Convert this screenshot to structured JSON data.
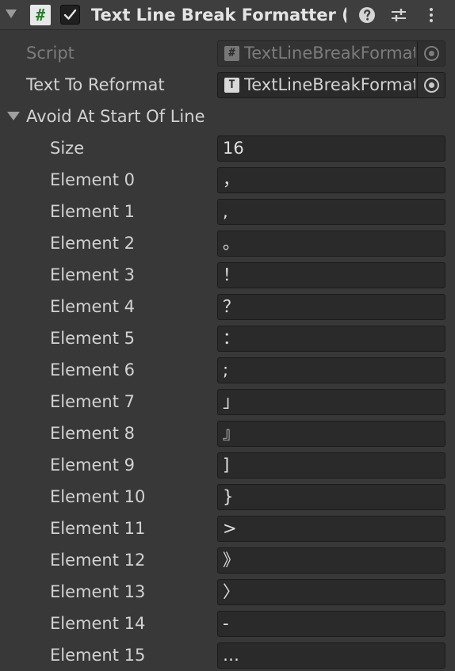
{
  "header": {
    "script_icon_glyph": "#",
    "title": "Text Line Break Formatter (Script)",
    "icons": [
      "foldout-arrow-icon",
      "script-icon",
      "checkbox-icon",
      "help-icon",
      "presets-icon",
      "context-menu-icon"
    ]
  },
  "props": {
    "script_label": "Script",
    "script_value": "TextLineBreakFormatter",
    "script_icon_glyph": "#",
    "text_label": "Text To Reformat",
    "text_value": "TextLineBreakFormatter",
    "text_icon_glyph": "T"
  },
  "avoid": {
    "label": "Avoid At Start Of Line",
    "size_label": "Size",
    "size_value": "16",
    "elements": [
      {
        "label": "Element 0",
        "value": "，"
      },
      {
        "label": "Element 1",
        "value": ","
      },
      {
        "label": "Element 2",
        "value": "。"
      },
      {
        "label": "Element 3",
        "value": "！"
      },
      {
        "label": "Element 4",
        "value": "？"
      },
      {
        "label": "Element 5",
        "value": "："
      },
      {
        "label": "Element 6",
        "value": ";"
      },
      {
        "label": "Element 7",
        "value": "」"
      },
      {
        "label": "Element 8",
        "value": "』"
      },
      {
        "label": "Element 9",
        "value": "]"
      },
      {
        "label": "Element 10",
        "value": "}"
      },
      {
        "label": "Element 11",
        "value": ">"
      },
      {
        "label": "Element 12",
        "value": "》"
      },
      {
        "label": "Element 13",
        "value": "〉"
      },
      {
        "label": "Element 14",
        "value": "-"
      },
      {
        "label": "Element 15",
        "value": "…"
      }
    ]
  },
  "colors": {
    "background": "#383838",
    "field": "#2a2a2a",
    "text": "#d2d2d2",
    "disabled_text": "#7c7c7c",
    "script_icon_green": "#2e7d32"
  }
}
